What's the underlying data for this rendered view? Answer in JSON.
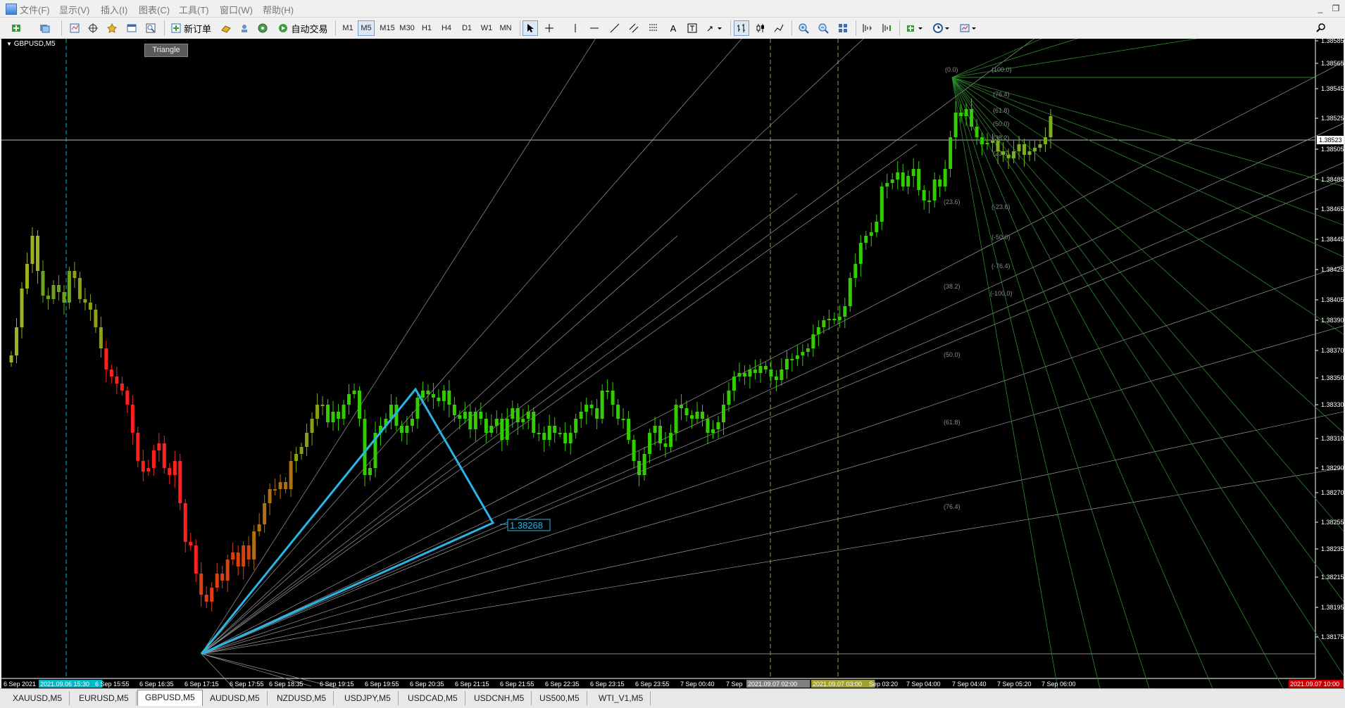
{
  "menu": {
    "items": [
      "文件(F)",
      "显示(V)",
      "插入(I)",
      "图表(C)",
      "工具(T)",
      "窗口(W)",
      "帮助(H)"
    ]
  },
  "toolbar": {
    "new_order_label": "新订单",
    "auto_trade_label": "自动交易",
    "timeframes": [
      "M1",
      "M5",
      "M15",
      "M30",
      "H1",
      "H4",
      "D1",
      "W1",
      "MN"
    ],
    "active_timeframe": "M5"
  },
  "tooltip": "Triangle",
  "chart": {
    "symbol": "GBPUSD,M5",
    "current_price": "1.38523",
    "triangle_price_label": "1.38268",
    "price_ticks": [
      "1.38585",
      "1.38565",
      "1.38545",
      "1.38525",
      "1.38505",
      "1.38485",
      "1.38465",
      "1.38445",
      "1.38425",
      "1.38405",
      "1.38390",
      "1.38370",
      "1.38350",
      "1.38330",
      "1.38310",
      "1.38290",
      "1.38270",
      "1.38255",
      "1.38235",
      "1.38215",
      "1.38195",
      "1.38175"
    ],
    "time_ticks": [
      "6 Sep 2021",
      "2021.09.06 15:30",
      "6 Sep 15:55",
      "6 Sep 16:35",
      "6 Sep 17:15",
      "6 Sep 17:55",
      "6 Sep 18:35",
      "6 Sep 19:15",
      "6 Sep 19:55",
      "6 Sep 20:35",
      "6 Sep 21:15",
      "6 Sep 21:55",
      "6 Sep 22:35",
      "6 Sep 23:15",
      "6 Sep 23:55",
      "7 Sep 00:40",
      "7 Sep",
      "2021.09.07 02:00",
      "2021.09.07 03:00",
      "Sep 03:20",
      "7 Sep 04:00",
      "7 Sep 04:40",
      "7 Sep 05:20",
      "7 Sep 06:00",
      "2021.09.07 10:00"
    ],
    "fib_fan_labels": [
      "(0.0)",
      "(23.6)",
      "(38.2)",
      "(50.0)",
      "(61.8)",
      "(76.4)"
    ],
    "fib_right_labels": [
      "(100.0)",
      "(76.4)",
      "(61.8)",
      "(50.0)",
      "(38.2)",
      "(23.6)",
      "(-23.6)",
      "(-50.0)",
      "(-76.4)",
      "(-100.0)"
    ]
  },
  "colors": {
    "bull": "#33cc00",
    "bear_red": "#ff2020",
    "triangle": "#29b6e6",
    "cursor_label_bg": "#ffffff"
  },
  "tabs": [
    "XAUUSD,M5",
    "EURUSD,M5",
    "GBPUSD,M5",
    "AUDUSD,M5",
    "NZDUSD,M5",
    "USDJPY,M5",
    "USDCAD,M5",
    "USDCNH,M5",
    "US500,M5",
    "WTI_V1,M5"
  ],
  "active_tab": "GBPUSD,M5"
}
